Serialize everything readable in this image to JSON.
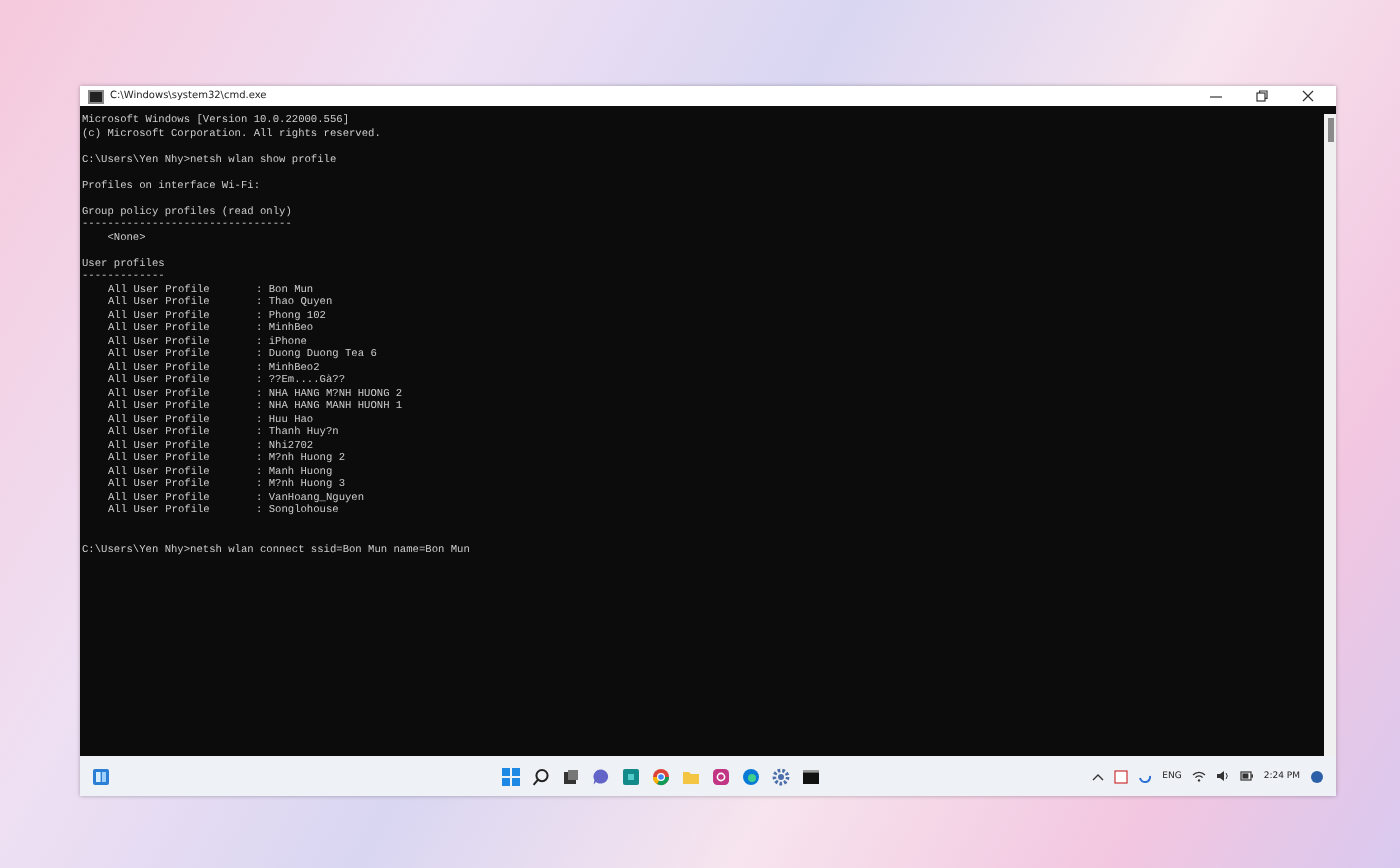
{
  "window": {
    "title": "C:\\Windows\\system32\\cmd.exe"
  },
  "console": {
    "lines": [
      {
        "kind": "text",
        "text": "Microsoft Windows [Version 10.0.22000.556]"
      },
      {
        "kind": "text",
        "text": "(c) Microsoft Corporation. All rights reserved."
      },
      {
        "kind": "gap"
      },
      {
        "kind": "text",
        "text": "C:\\Users\\Yen Nhy>netsh wlan show profile"
      },
      {
        "kind": "gap"
      },
      {
        "kind": "text",
        "text": "Profiles on interface Wi-Fi:"
      },
      {
        "kind": "gap"
      },
      {
        "kind": "text",
        "text": "Group policy profiles (read only)"
      },
      {
        "kind": "text",
        "text": "---------------------------------"
      },
      {
        "kind": "text",
        "text": "    <None>"
      },
      {
        "kind": "gap"
      },
      {
        "kind": "text",
        "text": "User profiles"
      },
      {
        "kind": "text",
        "text": "-------------"
      },
      {
        "kind": "profile",
        "label": "All User Profile",
        "value": ": Bon Mun"
      },
      {
        "kind": "profile",
        "label": "All User Profile",
        "value": ": Thao Quyen"
      },
      {
        "kind": "profile",
        "label": "All User Profile",
        "value": ": Phong 102"
      },
      {
        "kind": "profile",
        "label": "All User Profile",
        "value": ": MinhBeo"
      },
      {
        "kind": "profile",
        "label": "All User Profile",
        "value": ": iPhone"
      },
      {
        "kind": "profile",
        "label": "All User Profile",
        "value": ": Duong Duong Tea 6"
      },
      {
        "kind": "profile",
        "label": "All User Profile",
        "value": ": MinhBeo2"
      },
      {
        "kind": "profile",
        "label": "All User Profile",
        "value": ": ??Em....Gà??"
      },
      {
        "kind": "profile",
        "label": "All User Profile",
        "value": ": NHA HANG M?NH HUONG 2"
      },
      {
        "kind": "profile",
        "label": "All User Profile",
        "value": ": NHA HANG MANH HUONH 1"
      },
      {
        "kind": "profile",
        "label": "All User Profile",
        "value": ": Huu Hao"
      },
      {
        "kind": "profile",
        "label": "All User Profile",
        "value": ": Thanh Huy?n"
      },
      {
        "kind": "profile",
        "label": "All User Profile",
        "value": ": Nhi2702"
      },
      {
        "kind": "profile",
        "label": "All User Profile",
        "value": ": M?nh Huong 2"
      },
      {
        "kind": "profile",
        "label": "All User Profile",
        "value": ": Manh Huong"
      },
      {
        "kind": "profile",
        "label": "All User Profile",
        "value": ": M?nh Huong 3"
      },
      {
        "kind": "profile",
        "label": "All User Profile",
        "value": ": VanHoang_Nguyen"
      },
      {
        "kind": "profile",
        "label": "All User Profile",
        "value": ": Songlohouse"
      },
      {
        "kind": "gap"
      },
      {
        "kind": "gap"
      },
      {
        "kind": "text",
        "text": "C:\\Users\\Yen Nhy>netsh wlan connect ssid=Bon Mun name=Bon Mun"
      }
    ]
  },
  "taskbar": {
    "language": "ENG",
    "time": "2:24 PM"
  }
}
